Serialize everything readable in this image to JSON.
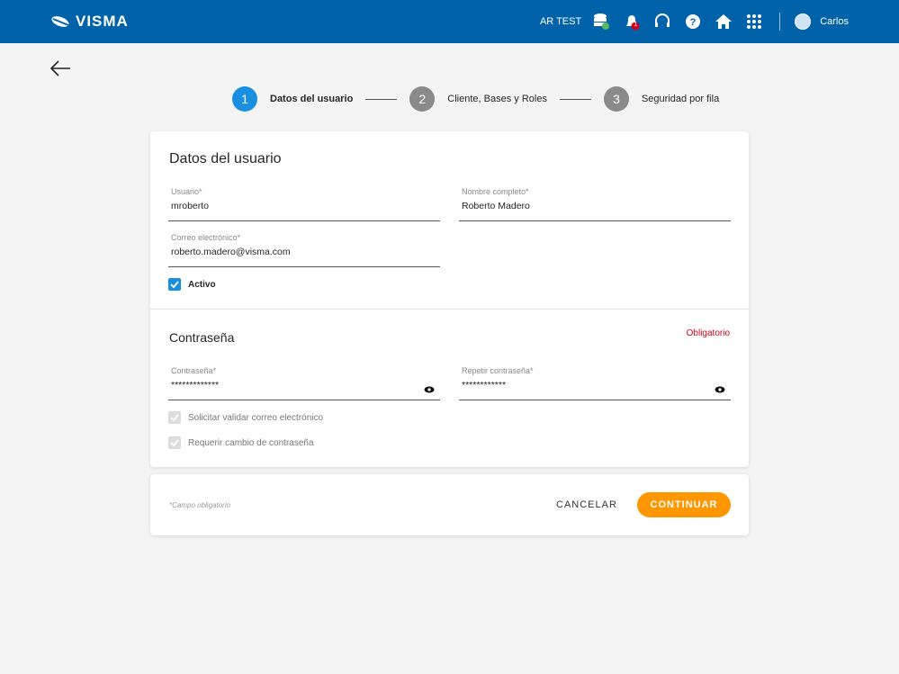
{
  "header": {
    "brand": "VISMA",
    "company": "AR TEST",
    "notification_count": "1",
    "user": "Carlos"
  },
  "stepper": [
    {
      "num": "1",
      "label": "Datos del usuario"
    },
    {
      "num": "2",
      "label": "Cliente, Bases y Roles"
    },
    {
      "num": "3",
      "label": "Seguridad por fila"
    }
  ],
  "user_section": {
    "title": "Datos del usuario",
    "usuario": {
      "label": "Usuario*",
      "value": "mroberto"
    },
    "nombre": {
      "label": "Nombre completo*",
      "value": "Roberto Madero"
    },
    "correo": {
      "label": "Correo electrónico*",
      "value": "roberto.madero@visma.com"
    },
    "activo": "Activo"
  },
  "password_section": {
    "title": "Contraseña",
    "required": "Obligatorio",
    "password": {
      "label": "Contraseña*",
      "value": "*************"
    },
    "repeat": {
      "label": "Repetir contraseña*",
      "value": "************"
    },
    "validate_email": "Solicitar validar correo electrónico",
    "require_change": "Requerir cambio de contraseña"
  },
  "footer": {
    "note": "*Campo obligatorio",
    "cancel": "CANCELAR",
    "continue": "CONTINUAR"
  },
  "colors": {
    "header": "#0062a8",
    "accent": "#1a8ee0",
    "primary_button": "#ff9700",
    "required": "#d0021b"
  }
}
